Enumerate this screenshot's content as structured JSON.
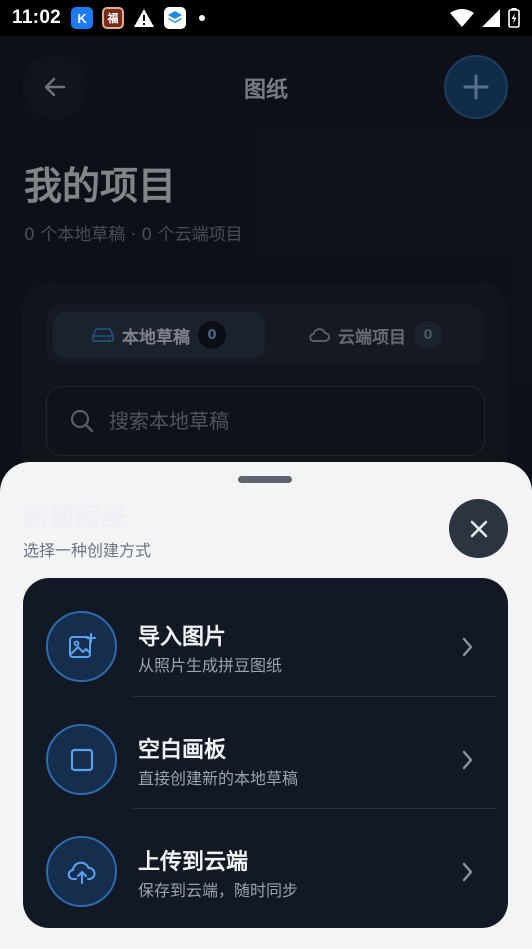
{
  "status_bar": {
    "time": "11:02",
    "app_icons": [
      "K",
      "福"
    ]
  },
  "header": {
    "title": "图纸",
    "back_icon": "arrow-left-icon",
    "add_icon": "plus-icon"
  },
  "projects": {
    "heading": "我的项目",
    "summary": "0 个本地草稿 · 0 个云端项目",
    "tabs": [
      {
        "label": "本地草稿",
        "count": "0",
        "icon": "drive-icon"
      },
      {
        "label": "云端项目",
        "count": "0",
        "icon": "cloud-icon"
      }
    ],
    "search": {
      "placeholder": "搜索本地草稿"
    }
  },
  "sheet": {
    "title": "新建图纸",
    "subtitle": "选择一种创建方式",
    "options": [
      {
        "title": "导入图片",
        "description": "从照片生成拼豆图纸",
        "icon": "image-add-icon"
      },
      {
        "title": "空白画板",
        "description": "直接创建新的本地草稿",
        "icon": "square-icon"
      },
      {
        "title": "上传到云端",
        "description": "保存到云端，随时同步",
        "icon": "cloud-upload-icon"
      }
    ]
  },
  "colors": {
    "accent": "#2f6bb0",
    "accent_bright": "#5aa2f0",
    "sheet_bg": "#f2f4f6",
    "card_bg": "#121824"
  }
}
